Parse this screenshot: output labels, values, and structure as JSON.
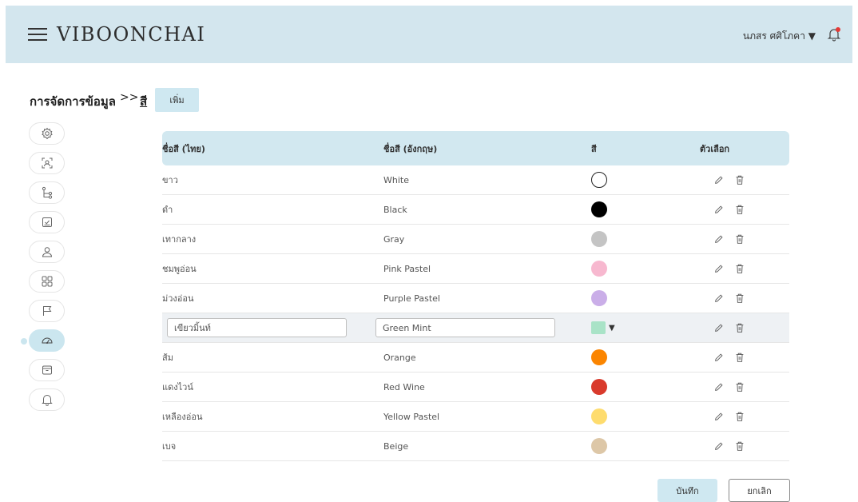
{
  "header": {
    "brand": "VIBOONCHAI",
    "user_label": "นภสร ศศิโภคา ▼",
    "menu_icon": "hamburger-icon",
    "notification_icon": "bell-icon"
  },
  "breadcrumb": {
    "root": "การจัดการข้อมูล",
    "separator": ">>",
    "current": "สี",
    "add_label": "เพิ่ม"
  },
  "sidebar": {
    "items": [
      {
        "icon": "gear-icon"
      },
      {
        "icon": "face-scan-icon"
      },
      {
        "icon": "flow-icon"
      },
      {
        "icon": "checkbox-icon"
      },
      {
        "icon": "user-icon"
      },
      {
        "icon": "grid-icon"
      },
      {
        "icon": "flag-icon"
      },
      {
        "icon": "gauge-icon",
        "active": true
      },
      {
        "icon": "box-icon"
      },
      {
        "icon": "bell-icon"
      }
    ]
  },
  "table": {
    "headers": [
      "ชื่อสี (ไทย)",
      "ชื่อสี (อังกฤษ)",
      "สี",
      "ตัวเลือก"
    ],
    "rows": [
      {
        "th": "ขาว",
        "en": "White",
        "color": "#ffffff"
      },
      {
        "th": "ดำ",
        "en": "Black",
        "color": "#000000"
      },
      {
        "th": "เทากลาง",
        "en": "Gray",
        "color": "#c4c4c4"
      },
      {
        "th": "ชมพูอ่อน",
        "en": "Pink Pastel",
        "color": "#f7b8cf"
      },
      {
        "th": "ม่วงอ่อน",
        "en": "Purple Pastel",
        "color": "#caaee8"
      },
      {
        "th": "เขียวมิ้นท์",
        "en": "Green Mint",
        "color": "#a9e3c7",
        "editing": true
      },
      {
        "th": "ส้ม",
        "en": "Orange",
        "color": "#fb8500"
      },
      {
        "th": "แดงไวน์",
        "en": "Red Wine",
        "color": "#d93a2c"
      },
      {
        "th": "เหลืองอ่อน",
        "en": "Yellow Pastel",
        "color": "#fedc6e"
      },
      {
        "th": "เบจ",
        "en": "Beige",
        "color": "#ddc7a7"
      }
    ]
  },
  "footer": {
    "save_label": "บันทึก",
    "cancel_label": "ยกเลิก"
  }
}
